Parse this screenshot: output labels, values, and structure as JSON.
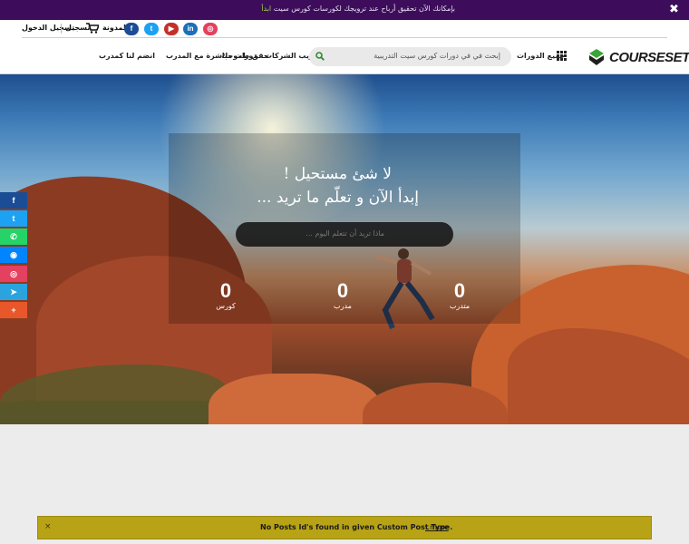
{
  "promo": {
    "text": "بإمكانك الآن تحقيق أرباح عند ترويجك لكورسات كورس سيت",
    "link": "ابدأ",
    "close_icon": "close-icon"
  },
  "topbar": {
    "social": [
      {
        "icon": "instagram-icon",
        "glyph": "◎",
        "color": "#e4405f"
      },
      {
        "icon": "linkedin-icon",
        "glyph": "in",
        "color": "#1d6fb8"
      },
      {
        "icon": "youtube-icon",
        "glyph": "▶",
        "color": "#c4302b"
      },
      {
        "icon": "twitter-icon",
        "glyph": "t",
        "color": "#1da1f2"
      },
      {
        "icon": "facebook-icon",
        "glyph": "f",
        "color": "#1b4c96"
      }
    ],
    "blog": "المدونة",
    "register": "تسجيل",
    "login": "تسجيل الدخول"
  },
  "nav": {
    "logo": "COURSESET",
    "all_courses": "جميع الدورات",
    "search_placeholder": "إبحث في في دورات كورس سيت التدريبية",
    "links": [
      "تدريب الشركات",
      "حقق طموحك",
      "دورات مباشرة مع المدرب",
      "انضم لنا كمدرب"
    ]
  },
  "hero": {
    "headline_1": "لا شئ مستحيل !",
    "headline_2": "إبدأ الآن و تعلّم ما تريد ...",
    "search_placeholder": "ماذا تريد أن تتعلم اليوم ...",
    "stats": [
      {
        "value": "0",
        "label": "كورس"
      },
      {
        "value": "0",
        "label": "مدرب"
      },
      {
        "value": "0",
        "label": "متدرب"
      }
    ]
  },
  "share": [
    {
      "icon": "facebook-icon",
      "glyph": "f",
      "color": "#1b4c96"
    },
    {
      "icon": "twitter-icon",
      "glyph": "t",
      "color": "#1da1f2"
    },
    {
      "icon": "whatsapp-icon",
      "glyph": "✆",
      "color": "#25d366"
    },
    {
      "icon": "messenger-icon",
      "glyph": "◉",
      "color": "#0084ff"
    },
    {
      "icon": "instagram-icon",
      "glyph": "◎",
      "color": "#e4405f"
    },
    {
      "icon": "telegram-icon",
      "glyph": "➤",
      "color": "#2aa3df"
    },
    {
      "icon": "plus-icon",
      "glyph": "+",
      "color": "#e8572a"
    }
  ],
  "notice": {
    "message": "No Posts Id's found in given Custom Post Type.",
    "more": "..more",
    "close": "×"
  }
}
